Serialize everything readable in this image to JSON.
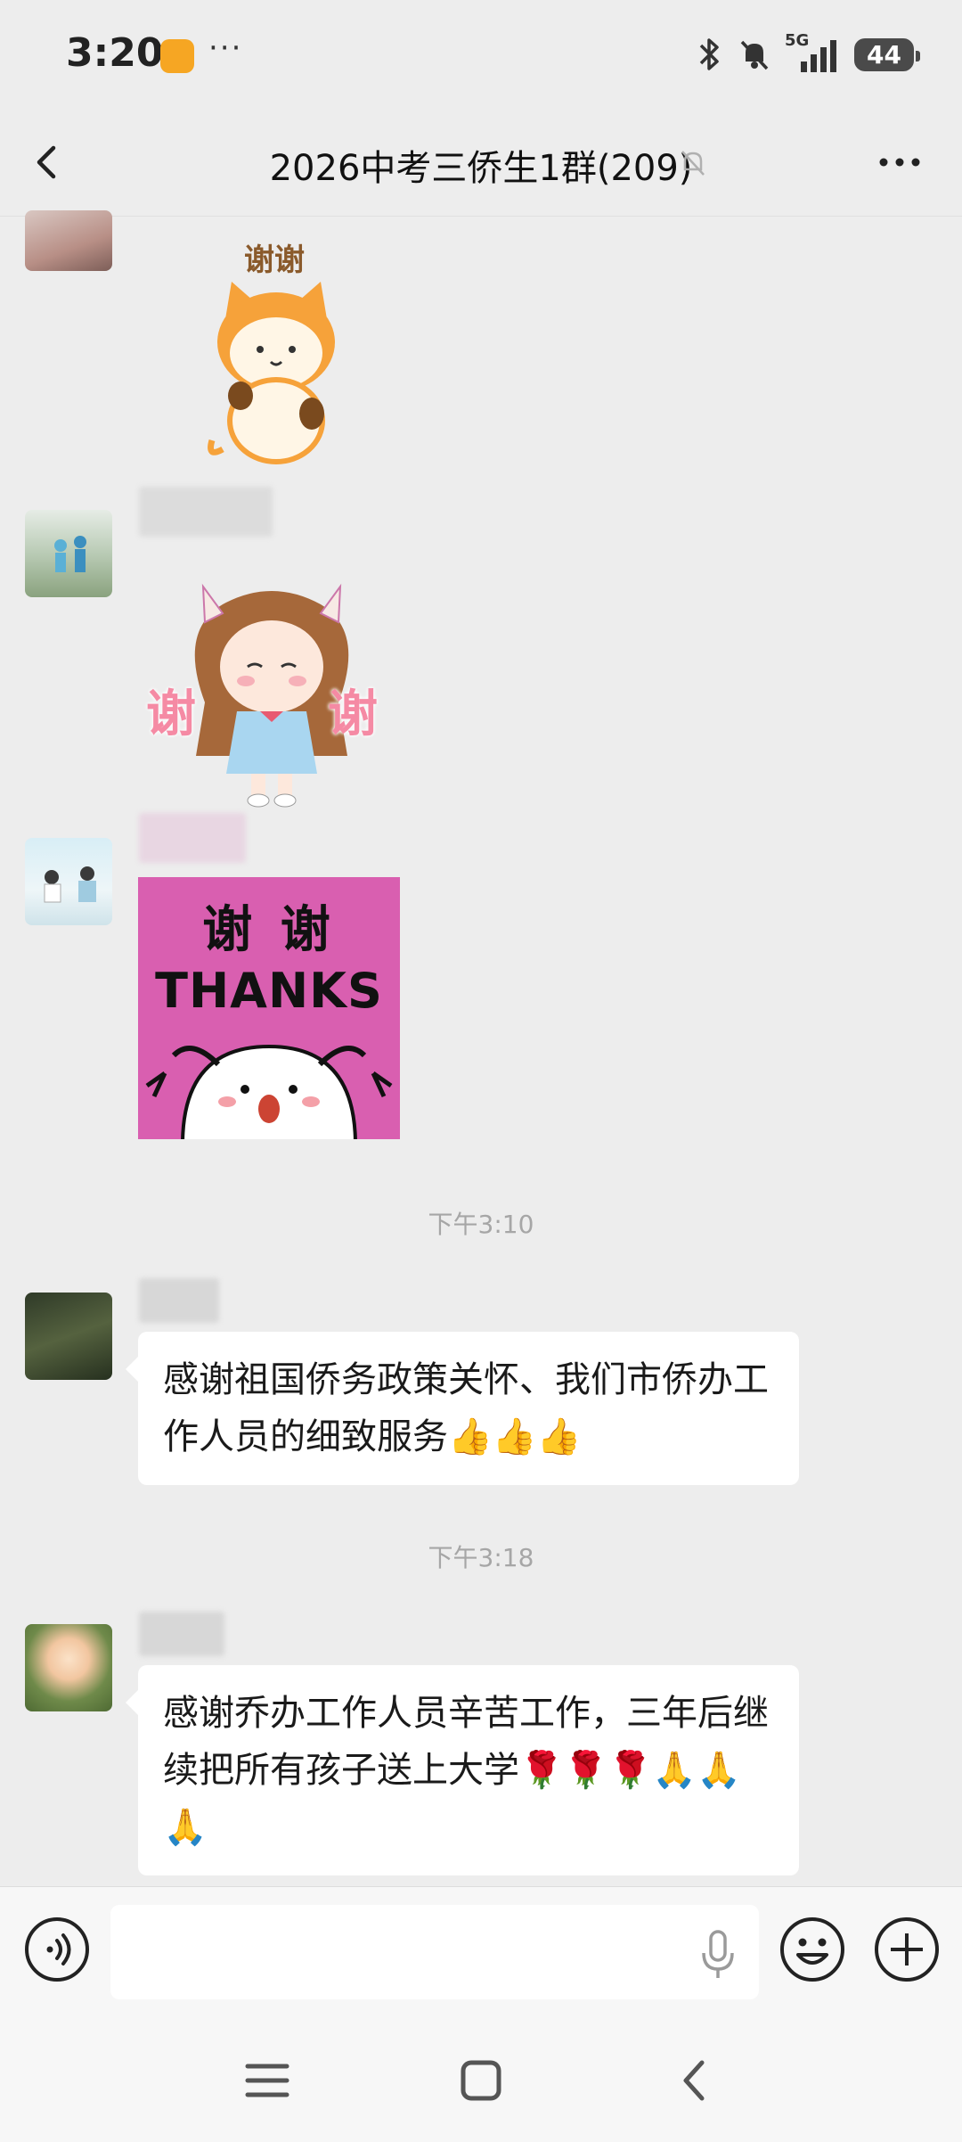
{
  "status_bar": {
    "time": "3:20",
    "more": "···",
    "network": "5G",
    "battery": "44"
  },
  "header": {
    "title": "2026中考三侨生1群(209)"
  },
  "messages": [
    {
      "kind": "sticker",
      "sticker_text": "谢谢",
      "icon": "cat-sticker"
    },
    {
      "kind": "sticker",
      "sticker_left": "谢",
      "sticker_right": "谢",
      "icon": "girl-sticker"
    },
    {
      "kind": "sticker",
      "sticker_top": "谢 谢",
      "sticker_bottom": "THANKS",
      "icon": "thanks-sticker"
    },
    {
      "kind": "timestamp",
      "text": "下午3:10"
    },
    {
      "kind": "text",
      "text": "感谢祖国侨务政策关怀、我们市侨办工作人员的细致服务👍👍👍"
    },
    {
      "kind": "timestamp",
      "text": "下午3:18"
    },
    {
      "kind": "text",
      "text": "感谢乔办工作人员辛苦工作，三年后继续把所有孩子送上大学🌹🌹🌹🙏🙏🙏"
    }
  ],
  "input_bar": {
    "placeholder": ""
  },
  "colors": {
    "background": "#ededed",
    "bubble": "#ffffff",
    "sticker_pink": "#d95fb0"
  }
}
